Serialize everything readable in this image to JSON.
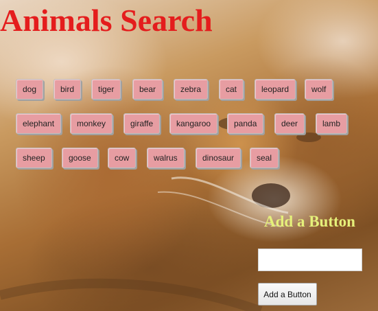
{
  "page": {
    "title": "Animals Search"
  },
  "animals": [
    "dog",
    "bird",
    "tiger",
    "bear",
    "zebra",
    "cat",
    "leopard",
    "wolf",
    "elephant",
    "monkey",
    "giraffe",
    "kangaroo",
    "panda",
    "deer",
    "lamb",
    "sheep",
    "goose",
    "cow",
    "walrus",
    "dinosaur",
    "seal"
  ],
  "add_form": {
    "heading": "Add a Button",
    "input_value": "",
    "input_placeholder": "",
    "button_label": "Add a Button"
  },
  "colors": {
    "title": "#e41d1d",
    "animal_button_bg": "#e79da2",
    "add_heading": "#e5f07a"
  },
  "background": {
    "image": "lions-photo"
  }
}
